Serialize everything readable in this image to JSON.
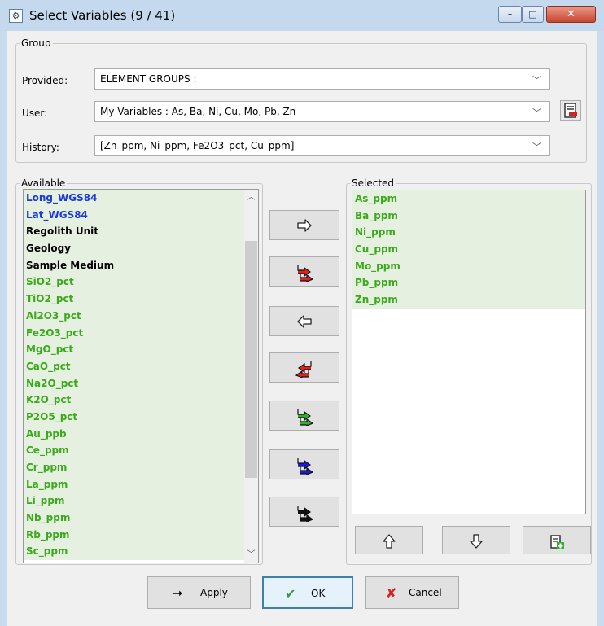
{
  "window": {
    "title": "Select Variables (9 / 41)",
    "close_glyph": "✕",
    "min_glyph": "–",
    "max_glyph": "□"
  },
  "group": {
    "legend": "Group",
    "provided": {
      "label": "Provided:",
      "value": "ELEMENT GROUPS :"
    },
    "user": {
      "label": "User:",
      "value": "My Variables : As, Ba, Ni, Cu, Mo, Pb, Zn"
    },
    "history": {
      "label": "History:",
      "value": "[Zn_ppm, Ni_ppm, Fe2O3_pct, Cu_ppm]"
    }
  },
  "available": {
    "legend": "Available",
    "items": [
      {
        "label": "Long_WGS84",
        "color": "blue"
      },
      {
        "label": "Lat_WGS84",
        "color": "blue"
      },
      {
        "label": "Regolith Unit",
        "color": "black"
      },
      {
        "label": "Geology",
        "color": "black"
      },
      {
        "label": "Sample Medium",
        "color": "black"
      },
      {
        "label": "SiO2_pct",
        "color": "green"
      },
      {
        "label": "TiO2_pct",
        "color": "green"
      },
      {
        "label": "Al2O3_pct",
        "color": "green"
      },
      {
        "label": "Fe2O3_pct",
        "color": "green"
      },
      {
        "label": "MgO_pct",
        "color": "green"
      },
      {
        "label": "CaO_pct",
        "color": "green"
      },
      {
        "label": "Na2O_pct",
        "color": "green"
      },
      {
        "label": "K2O_pct",
        "color": "green"
      },
      {
        "label": "P2O5_pct",
        "color": "green"
      },
      {
        "label": "Au_ppb",
        "color": "green"
      },
      {
        "label": "Ce_ppm",
        "color": "green"
      },
      {
        "label": "Cr_ppm",
        "color": "green"
      },
      {
        "label": "La_ppm",
        "color": "green"
      },
      {
        "label": "Li_ppm",
        "color": "green"
      },
      {
        "label": "Nb_ppm",
        "color": "green"
      },
      {
        "label": "Rb_ppm",
        "color": "green"
      },
      {
        "label": "Sc_ppm",
        "color": "green"
      }
    ]
  },
  "selected": {
    "legend": "Selected",
    "items": [
      {
        "label": "As_ppm",
        "color": "green"
      },
      {
        "label": "Ba_ppm",
        "color": "green"
      },
      {
        "label": "Ni_ppm",
        "color": "green"
      },
      {
        "label": "Cu_ppm",
        "color": "green"
      },
      {
        "label": "Mo_ppm",
        "color": "green"
      },
      {
        "label": "Pb_ppm",
        "color": "green"
      },
      {
        "label": "Zn_ppm",
        "color": "green"
      }
    ]
  },
  "buttons": {
    "apply": "Apply",
    "ok": "OK",
    "cancel": "Cancel"
  },
  "colors": {
    "blue": "#1a3adb",
    "black": "#000000",
    "green": "#3aaa1a",
    "red": "#e02020",
    "navy": "#1a1adb",
    "ok_check": "#2f9e3a",
    "cancel_x": "#d92020"
  }
}
